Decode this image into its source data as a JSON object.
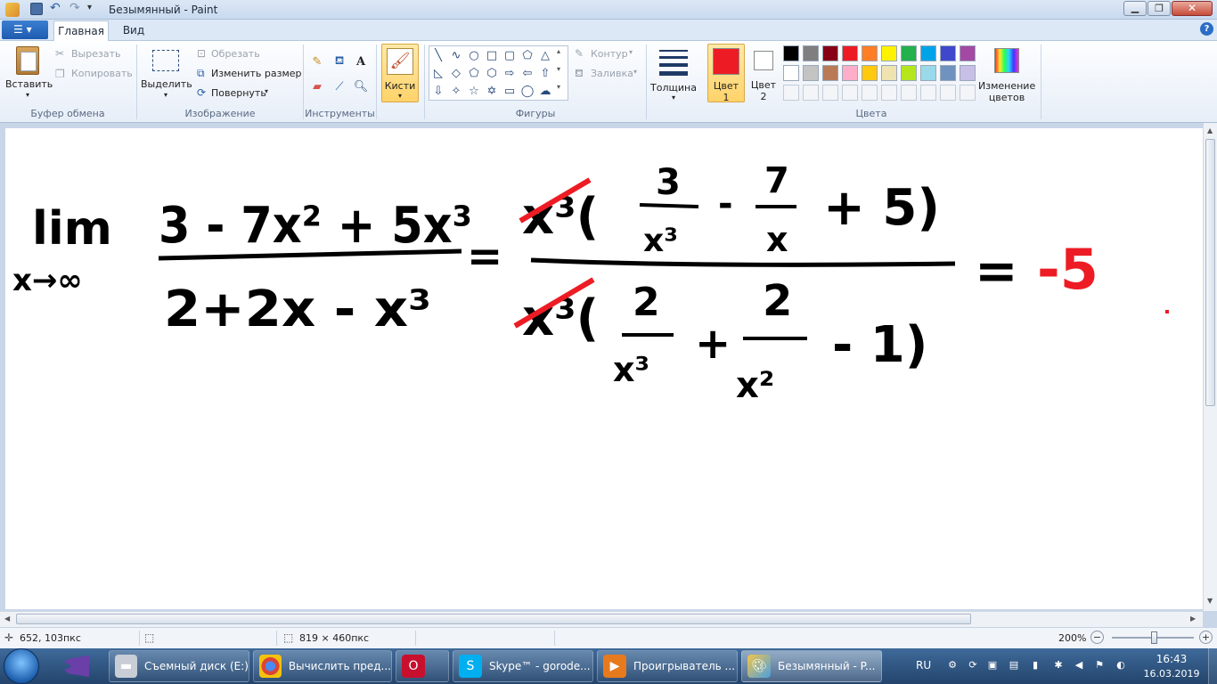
{
  "titlebar": {
    "title": "Безымянный - Paint"
  },
  "tabs": {
    "home": "Главная",
    "view": "Вид"
  },
  "clipboard": {
    "paste": "Вставить",
    "cut": "Вырезать",
    "copy": "Копировать",
    "group": "Буфер обмена"
  },
  "image": {
    "select": "Выделить",
    "crop": "Обрезать",
    "resize": "Изменить размер",
    "rotate": "Повернуть",
    "group": "Изображение"
  },
  "tools": {
    "group": "Инструменты"
  },
  "brushes": {
    "label": "Кисти"
  },
  "shapes": {
    "outline": "Контур",
    "fill": "Заливка",
    "group": "Фигуры"
  },
  "size": {
    "label": "Толщина"
  },
  "colors": {
    "color1_label": "Цвет",
    "color1_num": "1",
    "color2_label": "Цвет",
    "color2_num": "2",
    "edit_label": "Изменение",
    "edit_label2": "цветов",
    "group": "Цвета",
    "color1_value": "#ed1c24",
    "color2_value": "#ffffff",
    "palette_row1": [
      "#000000",
      "#7f7f7f",
      "#880015",
      "#ed1c24",
      "#ff7f27",
      "#fff200",
      "#22b14c",
      "#00a2e8",
      "#3f48cc",
      "#a349a4"
    ],
    "palette_row2": [
      "#ffffff",
      "#c3c3c3",
      "#b97a57",
      "#ffaec9",
      "#ffc90e",
      "#efe4b0",
      "#b5e61d",
      "#99d9ea",
      "#7092be",
      "#c8bfe7"
    ]
  },
  "status": {
    "cursor": "652, 103пкс",
    "size": "819 × 460пкс",
    "zoom": "200%"
  },
  "taskbar": {
    "items": [
      "Съемный диск (E:)",
      "Вычислить пред...",
      "Skype™ - gorode...",
      "Проигрыватель ...",
      "Безымянный - P..."
    ],
    "lang": "RU",
    "time": "16:43",
    "date": "16.03.2019"
  },
  "drawing": {
    "lim": "lim",
    "arrow": "x→∞",
    "num1": "3 - 7x² + 5x³",
    "den1": "2+2x - x³",
    "eq1": "=",
    "num2_a": "x³(",
    "num2_b": "3",
    "num2_c": "x³",
    "num2_d": "-",
    "num2_e": "7",
    "num2_f": "x",
    "num2_g": "+ 5)",
    "den2_a": "x³(",
    "den2_b": "2",
    "den2_c": "x³",
    "den2_d": "+",
    "den2_e": "2",
    "den2_f": "x²",
    "den2_g": "- 1)",
    "eq2": "=",
    "answer": "-5"
  }
}
